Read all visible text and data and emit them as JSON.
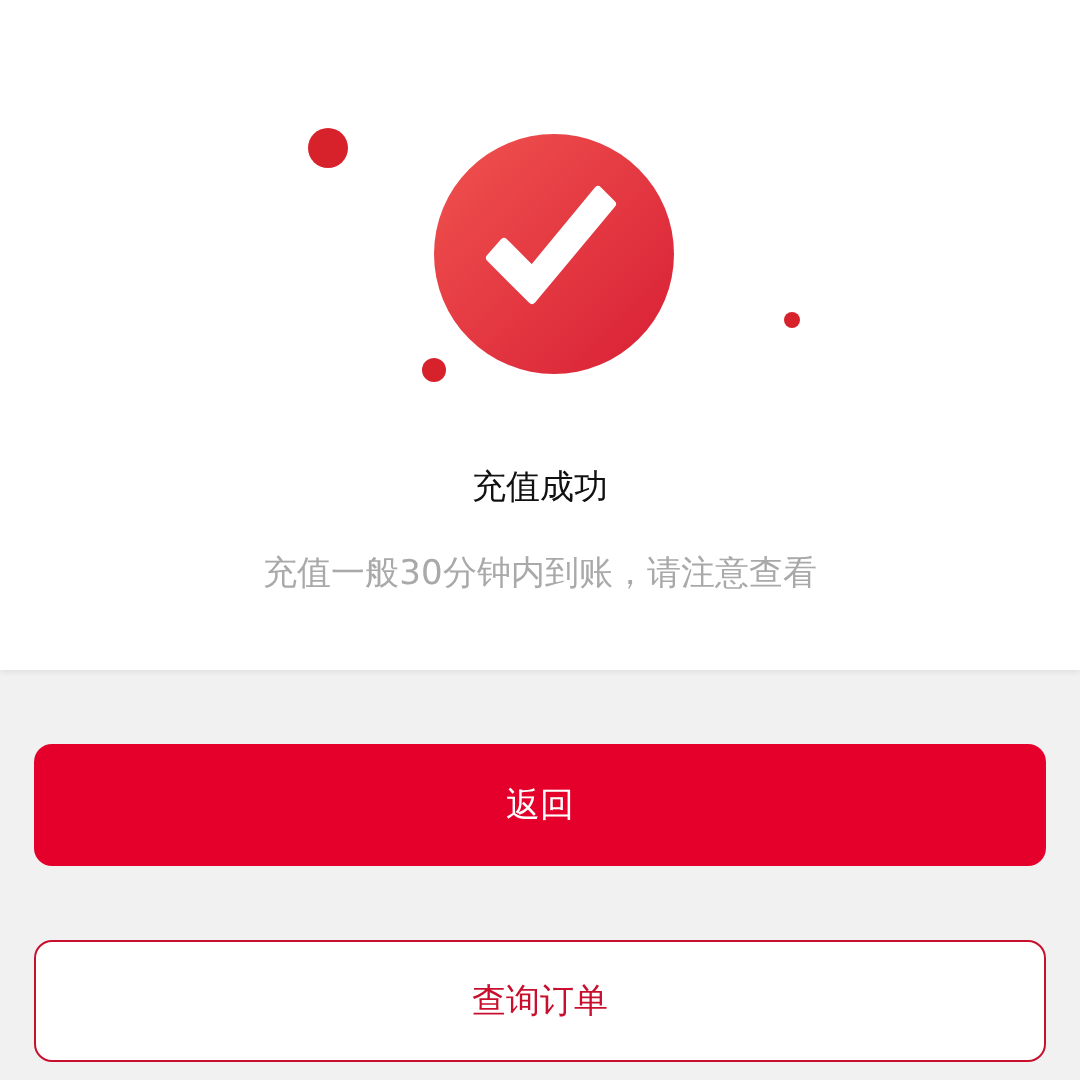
{
  "result": {
    "title": "充值成功",
    "message": "充值一般30分钟内到账，请注意查看"
  },
  "buttons": [
    {
      "label": "返回",
      "kind": "primary"
    },
    {
      "label": "查询订单",
      "kind": "outline"
    }
  ]
}
